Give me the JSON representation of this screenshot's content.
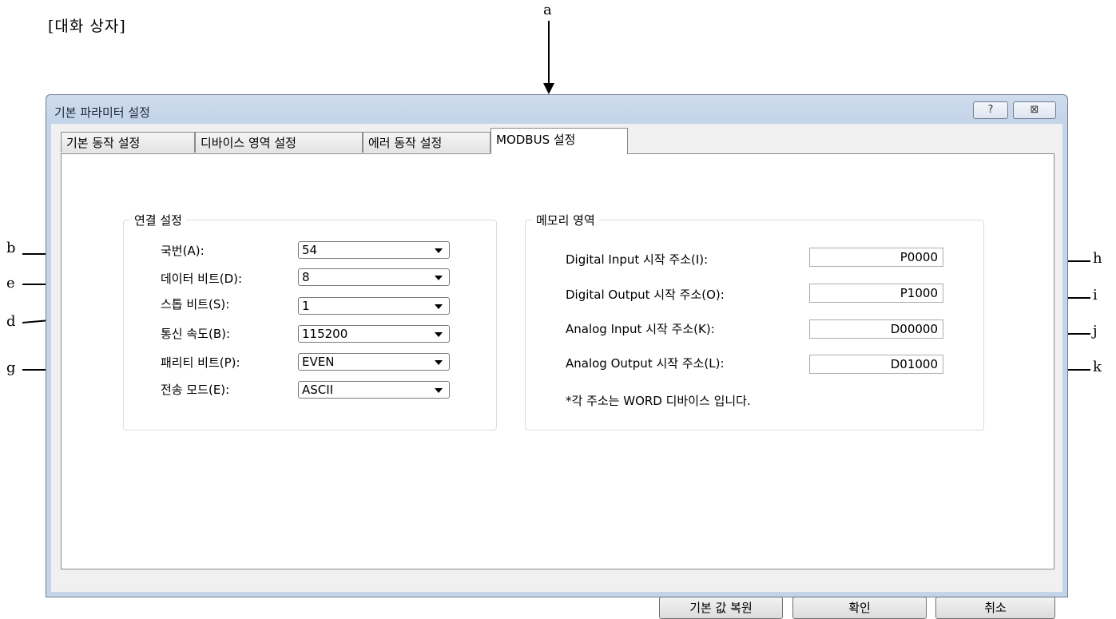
{
  "caption": "[대화 상자]",
  "callouts": {
    "a": "a",
    "b": "b",
    "e": "e",
    "d": "d",
    "g": "g",
    "h": "h",
    "i": "i",
    "j": "j",
    "k": "k"
  },
  "window": {
    "title": "기본 파라미터 설정",
    "help_label": "?",
    "close_label": "⊠"
  },
  "tabs": [
    {
      "label": "기본 동작 설정"
    },
    {
      "label": "디바이스 영역 설정"
    },
    {
      "label": "에러 동작 설정"
    },
    {
      "label": "MODBUS 설정"
    }
  ],
  "connection": {
    "title": "연결 설정",
    "station_label": "국번(A):",
    "station_value": "54",
    "databits_label": "데이터 비트(D):",
    "databits_value": "8",
    "stopbits_label": "스톱 비트(S):",
    "stopbits_value": "1",
    "baud_label": "통신 속도(B):",
    "baud_value": "115200",
    "parity_label": "패리티 비트(P):",
    "parity_value": "EVEN",
    "mode_label": "전송 모드(E):",
    "mode_value": "ASCII"
  },
  "memory": {
    "title": "메모리 영역",
    "di_label": "Digital Input 시작 주소(I):",
    "di_value": "P0000",
    "do_label": "Digital Output 시작 주소(O):",
    "do_value": "P1000",
    "ai_label": "Analog Input 시작 주소(K):",
    "ai_value": "D00000",
    "ao_label": "Analog Output 시작 주소(L):",
    "ao_value": "D01000",
    "note": "*각 주소는 WORD 디바이스 입니다."
  },
  "buttons": {
    "restore": "기본 값 복원",
    "ok": "확인",
    "cancel": "취소"
  }
}
